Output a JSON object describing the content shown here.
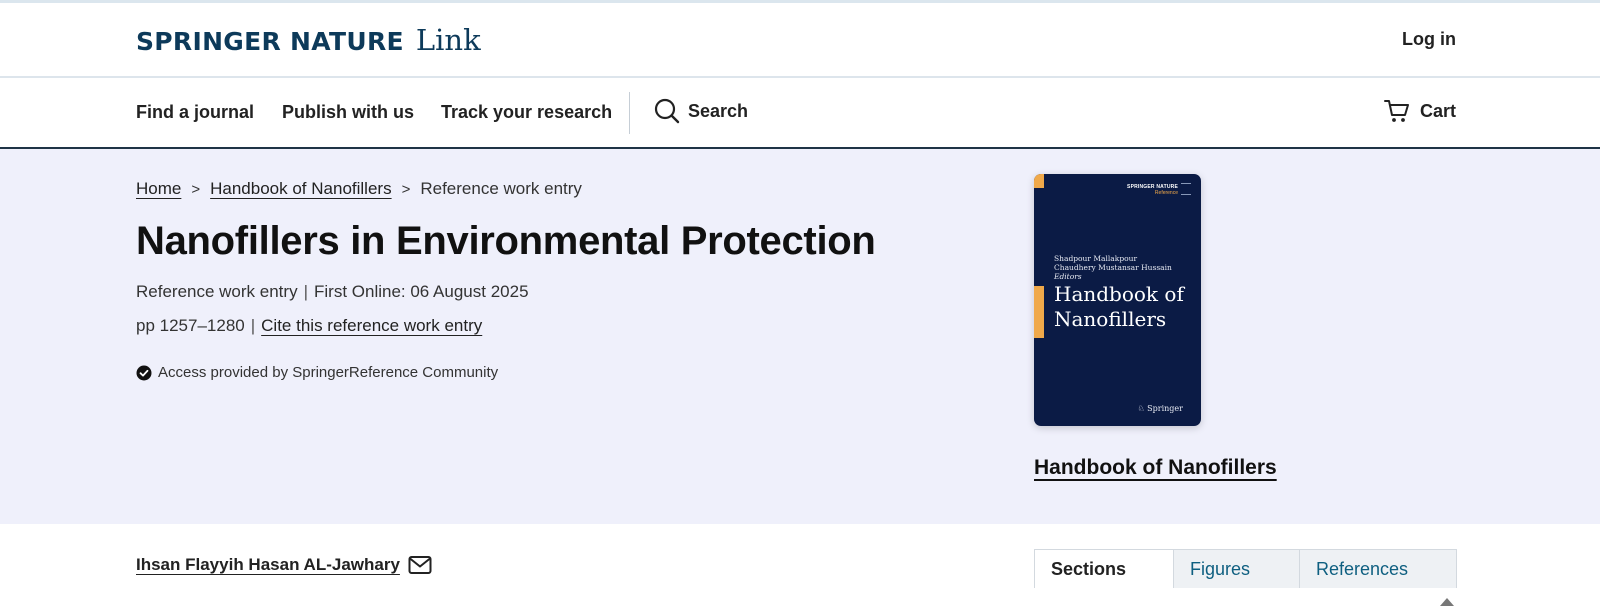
{
  "header": {
    "logo_brand": "SPRINGER NATURE",
    "logo_sub": "Link",
    "login_label": "Log in"
  },
  "nav": {
    "find_journal": "Find a journal",
    "publish": "Publish with us",
    "track": "Track your research",
    "search_label": "Search",
    "cart_label": "Cart"
  },
  "breadcrumb": {
    "home": "Home",
    "book": "Handbook of Nanofillers",
    "current": "Reference work entry"
  },
  "article": {
    "title": "Nanofillers in Environmental Protection",
    "type": "Reference work entry",
    "first_online": "First Online: 06 August 2025",
    "pages": "pp 1257–1280",
    "cite_label": "Cite this reference work entry",
    "access_text": "Access provided by SpringerReference Community"
  },
  "book": {
    "cover_brand": "SPRINGER NATURE",
    "cover_brand_sub": "Reference",
    "cover_editor_1": "Shadpour Mallakpour",
    "cover_editor_2": "Chaudhery Mustansar Hussain",
    "cover_editors_label": "Editors",
    "cover_title_line1": "Handbook of",
    "cover_title_line2": "Nanofillers",
    "cover_publisher": "Springer",
    "link_label": "Handbook of Nanofillers"
  },
  "author": {
    "name": "Ihsan Flayyih Hasan AL-Jawhary"
  },
  "tabs": [
    {
      "label": "Sections"
    },
    {
      "label": "Figures"
    },
    {
      "label": "References"
    }
  ],
  "colors": {
    "brand_navy": "#0d3a5a",
    "hero_bg": "#eff0fb",
    "cover_bg": "#0b1b45",
    "cover_accent": "#f0a94a",
    "tab_link": "#0e5f80"
  }
}
